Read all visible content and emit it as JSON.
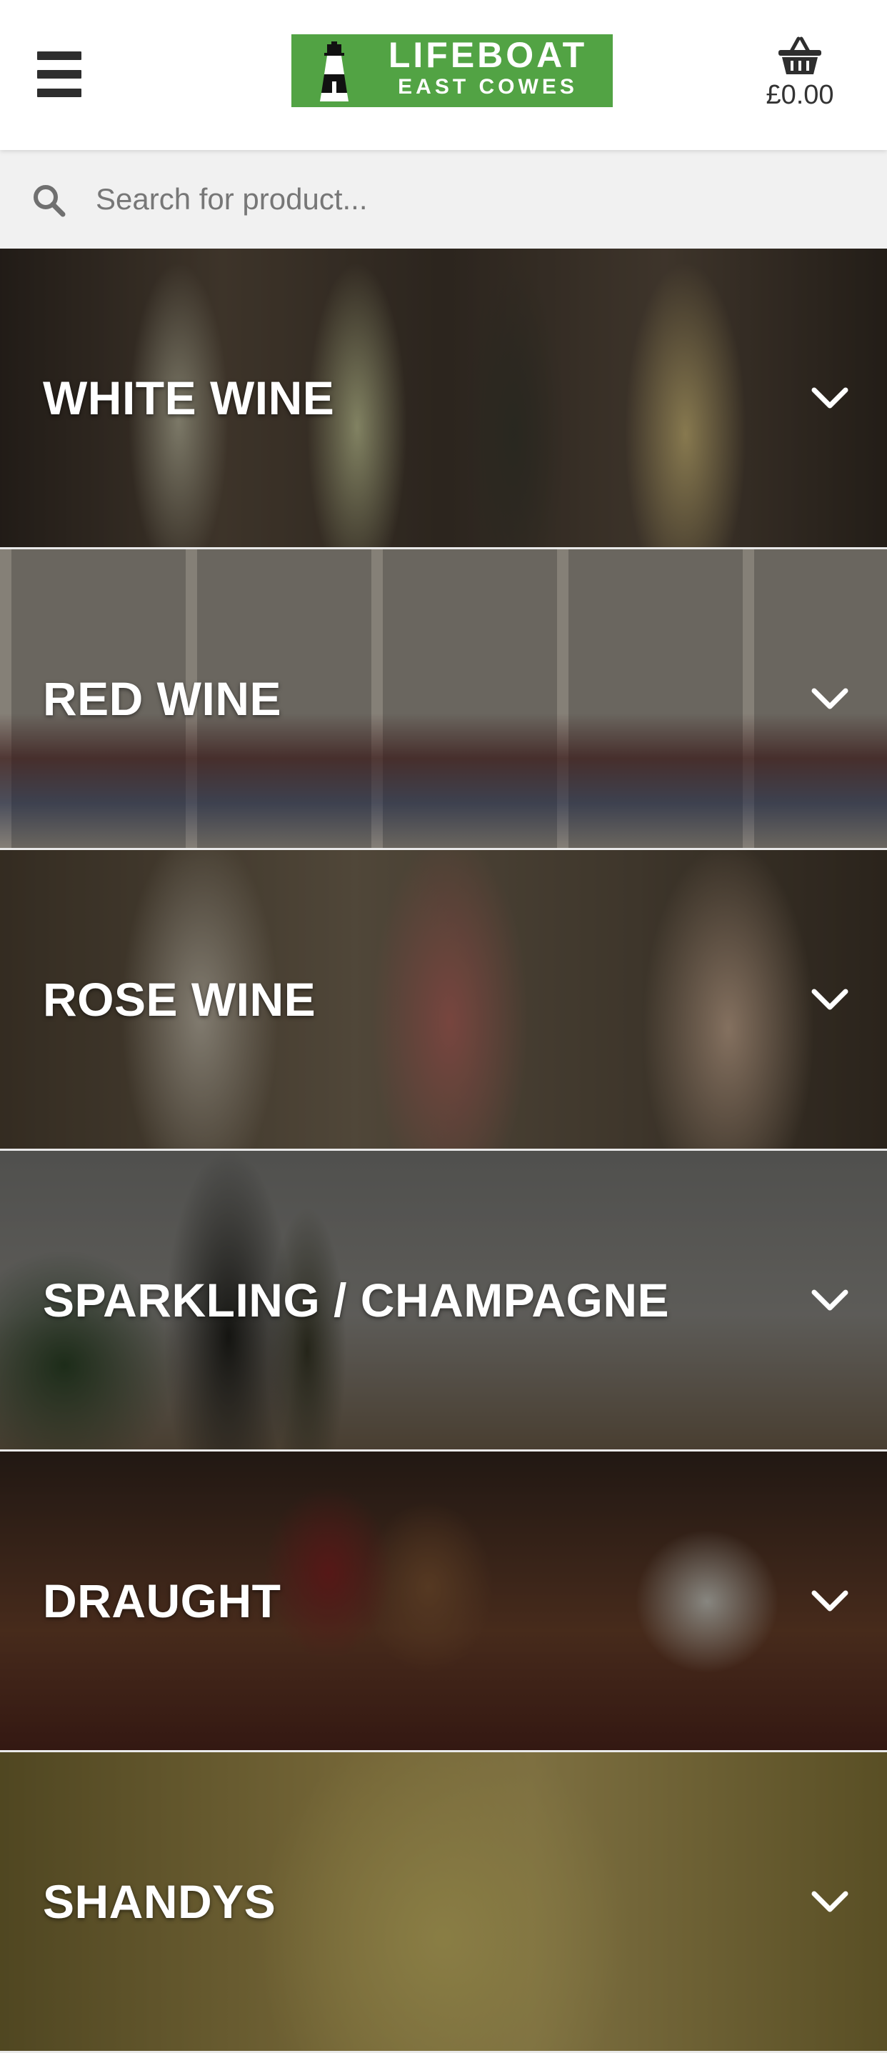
{
  "header": {
    "menu_label": "Menu",
    "logo": {
      "title": "LIFEBOAT",
      "subtitle": "EAST COWES",
      "background_color": "#52a344"
    },
    "cart": {
      "icon": "basket-icon",
      "total": "£0.00"
    }
  },
  "search": {
    "icon": "search-icon",
    "placeholder": "Search for product..."
  },
  "categories": [
    {
      "label": "WHITE WINE",
      "icon": "chevron-down-icon"
    },
    {
      "label": "RED WINE",
      "icon": "chevron-down-icon"
    },
    {
      "label": "ROSE WINE",
      "icon": "chevron-down-icon"
    },
    {
      "label": "SPARKLING / CHAMPAGNE",
      "icon": "chevron-down-icon"
    },
    {
      "label": "DRAUGHT",
      "icon": "chevron-down-icon"
    },
    {
      "label": "SHANDYS",
      "icon": "chevron-down-icon"
    }
  ]
}
